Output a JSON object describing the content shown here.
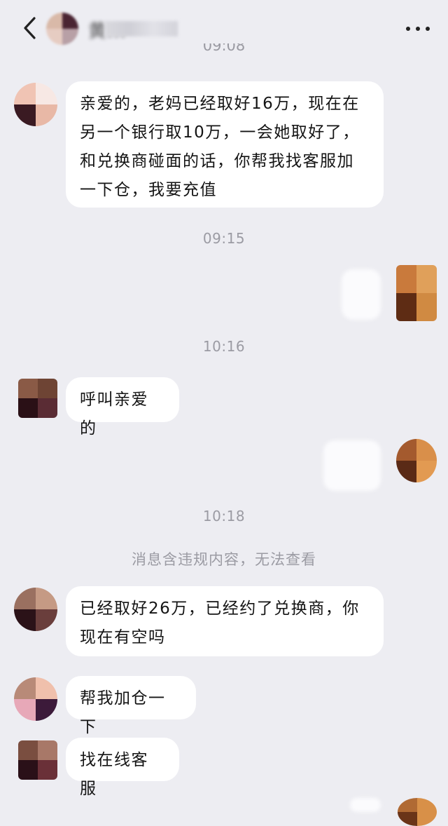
{
  "header": {
    "back_icon": "chevron-left-icon",
    "contact_name_visible": "黄...",
    "more_icon": "more-dots-icon"
  },
  "messages": [
    {
      "type": "time",
      "text": "09:08"
    },
    {
      "type": "incoming",
      "text": "亲爱的，老妈已经取好16万，现在在另一个银行取10万，一会她取好了，和兑换商碰面的话，你帮我找客服加一下仓，我要充值"
    },
    {
      "type": "time",
      "text": "09:15"
    },
    {
      "type": "outgoing",
      "text": ""
    },
    {
      "type": "time",
      "text": "10:16"
    },
    {
      "type": "incoming",
      "text": "呼叫亲爱的"
    },
    {
      "type": "outgoing",
      "text": ""
    },
    {
      "type": "time",
      "text": "10:18"
    },
    {
      "type": "system",
      "text": "消息含违规内容，无法查看"
    },
    {
      "type": "incoming",
      "text": "已经取好26万，已经约了兑换商，你现在有空吗"
    },
    {
      "type": "incoming",
      "text": "帮我加仓一下"
    },
    {
      "type": "incoming",
      "text": "找在线客服"
    }
  ],
  "colors": {
    "background": "#ededf2",
    "bubble_incoming": "#ffffff",
    "timestamp_text": "#9b9ba3"
  }
}
